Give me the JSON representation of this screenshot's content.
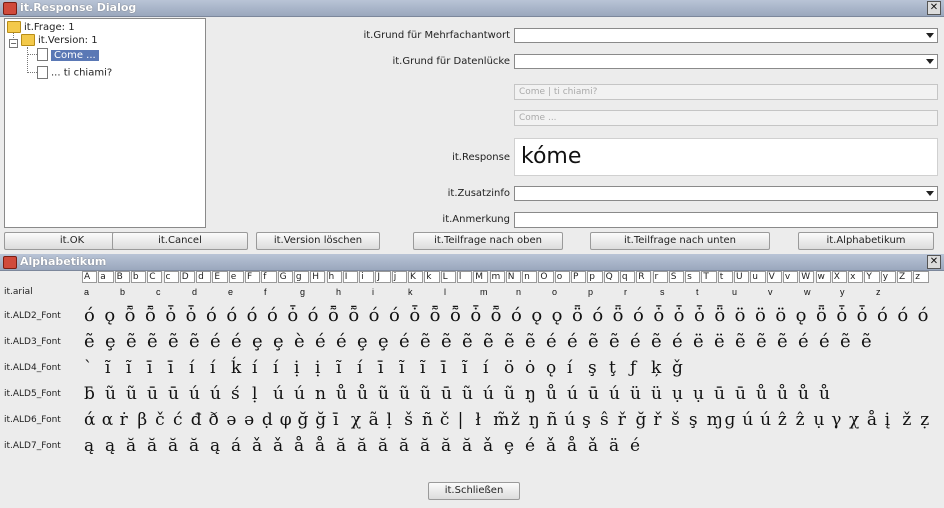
{
  "dialog": {
    "title": "it.Response Dialog",
    "tree": {
      "root": "it.Frage: 1",
      "version": "it.Version: 1",
      "item1": "Come ...",
      "item2": "... ti chiami?"
    },
    "fields": {
      "grund_mehrfach_label": "it.Grund für Mehrfachantwort",
      "grund_datenluecke_label": "it.Grund für Datenlücke",
      "readonly1": "Come | ti chiami?",
      "readonly2": "Come ...",
      "response_label": "it.Response",
      "response_value": "kóme",
      "zusatzinfo_label": "it.Zusatzinfo",
      "anmerkung_label": "it.Anmerkung"
    },
    "buttons": {
      "ok": "it.OK",
      "cancel": "it.Cancel",
      "version_loeschen": "it.Version löschen",
      "teilfrage_oben": "it.Teilfrage nach oben",
      "teilfrage_unten": "it.Teilfrage nach unten",
      "alphabetikum": "it.Alphabetikum"
    }
  },
  "alphabet": {
    "title": "Alphabetikum",
    "header_letters": [
      "A",
      "a",
      "B",
      "b",
      "C",
      "c",
      "D",
      "d",
      "E",
      "e",
      "F",
      "f",
      "G",
      "g",
      "H",
      "h",
      "I",
      "i",
      "J",
      "j",
      "K",
      "k",
      "L",
      "l",
      "M",
      "m",
      "N",
      "n",
      "O",
      "o",
      "P",
      "p",
      "Q",
      "q",
      "R",
      "r",
      "S",
      "s",
      "T",
      "t",
      "U",
      "u",
      "V",
      "v",
      "W",
      "w",
      "X",
      "x",
      "Y",
      "y",
      "Z",
      "z"
    ],
    "rows": [
      {
        "label": "it.arial",
        "glyphs": "a b c d e f g h i k l m n o p r s t u v w y z"
      },
      {
        "label": "it.ALD2_Font",
        "glyphs": "ó ǫ ȭ ȭ ȱ ȱ ó ó ó ó ȱ ó ȭ ȭ ó ó ȱ ȭ ȭ ȱ ȭ ó ǫ ǫ ȫ ó ȫ ó ȱ ȱ ȱ ȫ ö ö ö ǫ ȫ ȱ ȱ ó ó ó"
      },
      {
        "label": "it.ALD3_Font",
        "glyphs": "ẽ ȩ ẽ ẽ ẽ ẽ é é ȩ ȩ è é é ȩ ȩ é ẽ ẽ ẽ ẽ ẽ ẽ é é ẽ ẽ é ẽ é ë ë ẽ ẽ ẽ é é ẽ ẽ"
      },
      {
        "label": "it.ALD4_Font",
        "glyphs": "ˋ ĩ ĩ ī ī í í ḱ í í ị ị ĩ í ī ĩ ĩ ī ĩ í ö ȯ ǫ í ş ţ ƒ ķ ǧ"
      },
      {
        "label": "it.ALD5_Font",
        "glyphs": "ƃ ũ ũ ū ū ú ú ś ḷ ú ú n ů ů ũ ũ ũ ū ũ ú ũ ŋ ů ú ū ú ü ü ụ ụ ū ū ů ů ů ů"
      },
      {
        "label": "it.ALD6_Font",
        "glyphs": "ά α ṙ β č ć đ ð ə ə ḍ φ ğ ğ ī χ ã ḷ š ñ č | ł m̃ ž ŋ ñ ú ş ŝ ř ğ ř š ş ɱ ɡ ú ú ẑ ẑ ụ γ χ å į ž ẓ"
      },
      {
        "label": "it.ALD7_Font",
        "glyphs": "ą ą ă ă ă ă ą á ǎ ǎ å å ă ă ă ă ă ă ă ǎ ȩ é ǎ å ǎ ä é"
      }
    ],
    "close_button": "it.Schließen"
  }
}
